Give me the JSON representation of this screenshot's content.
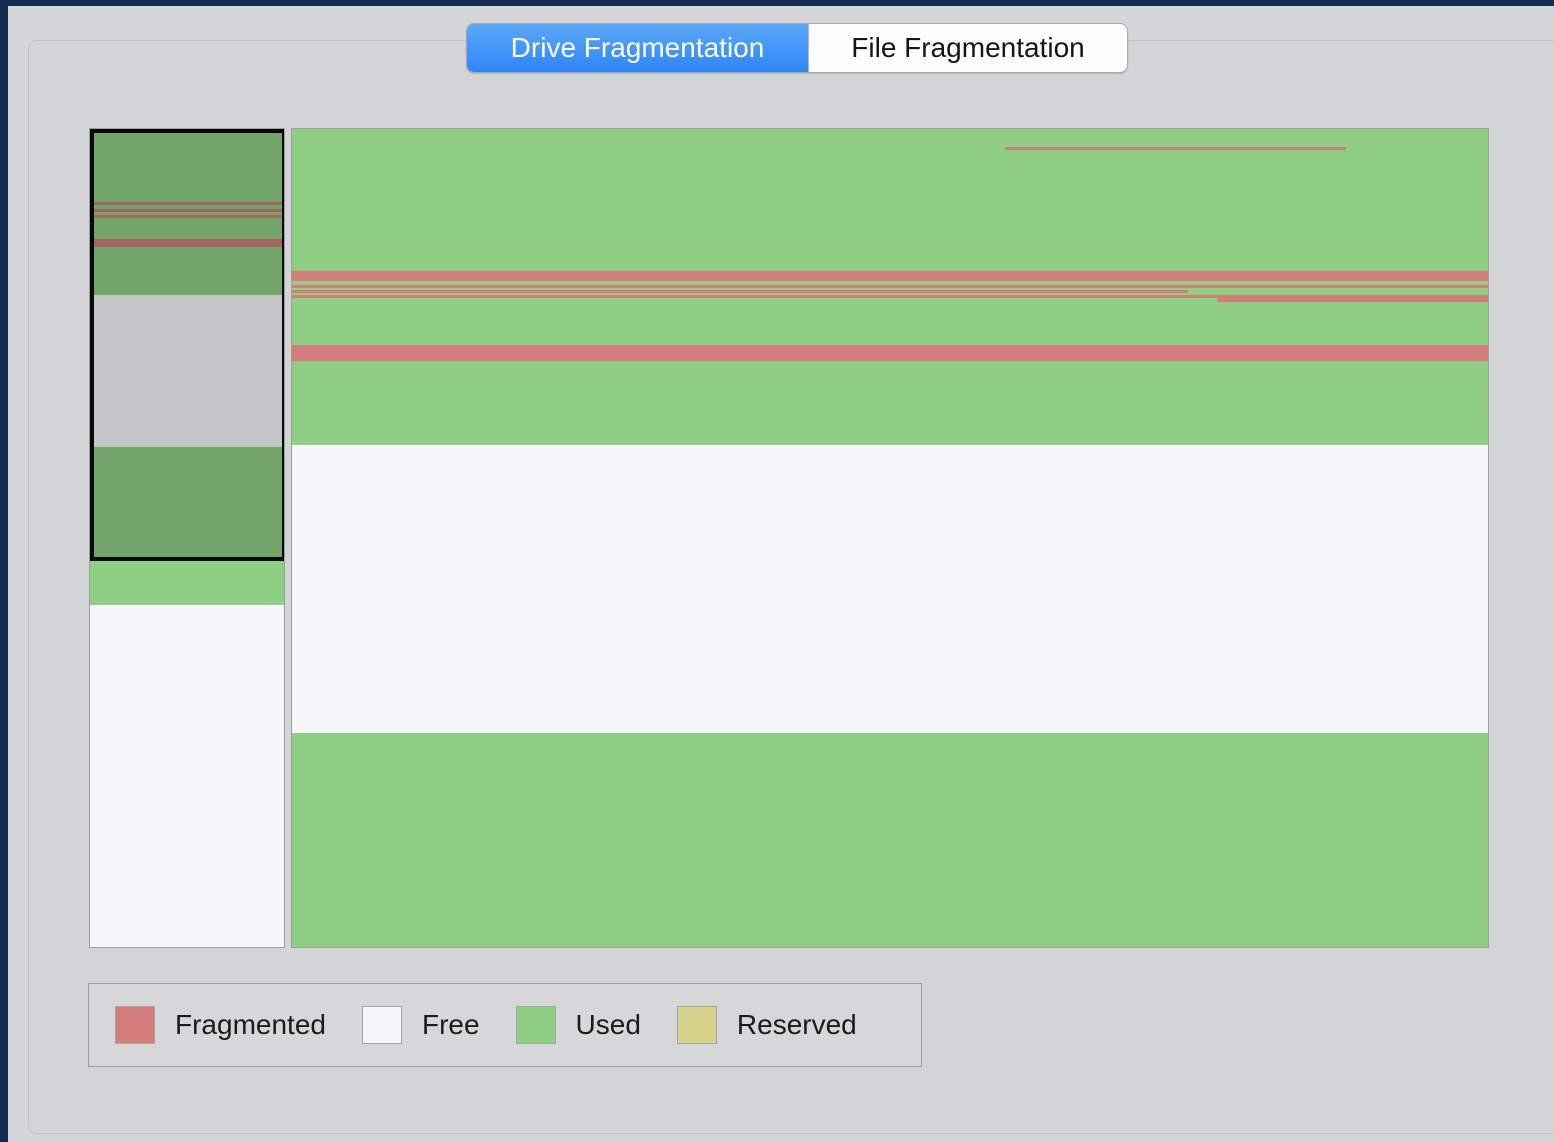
{
  "tabs": {
    "drive_label": "Drive Fragmentation",
    "file_label": "File Fragmentation",
    "selected": "drive"
  },
  "colors": {
    "fragmented": "#d47b7b",
    "free": "#f6f7f8",
    "used": "#8ecf84",
    "reserved": "#d6d28a",
    "selection_border": "#080808",
    "accent": "#2f86f6"
  },
  "legend": [
    {
      "key": "fragmented",
      "label": "Fragmented"
    },
    {
      "key": "free",
      "label": "Free"
    },
    {
      "key": "used",
      "label": "Used"
    },
    {
      "key": "reserved",
      "label": "Reserved"
    }
  ]
}
